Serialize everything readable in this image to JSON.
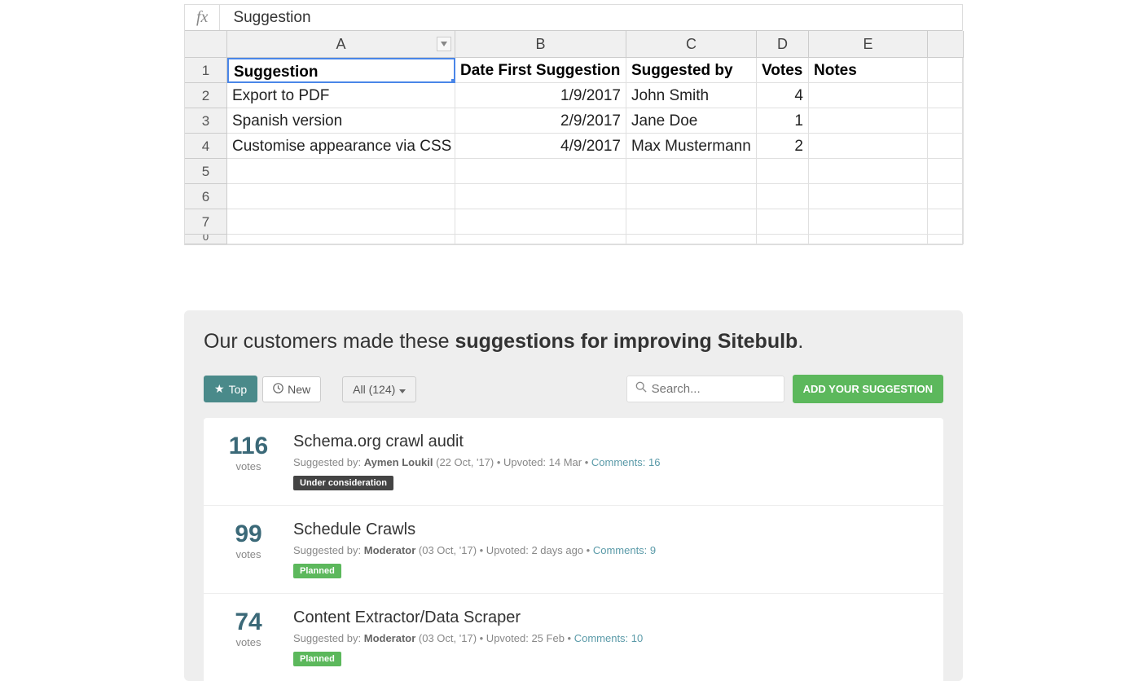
{
  "spreadsheet": {
    "formula_bar": "Suggestion",
    "columns": [
      "A",
      "B",
      "C",
      "D",
      "E"
    ],
    "row_numbers": [
      "1",
      "2",
      "3",
      "4",
      "5",
      "6",
      "7"
    ],
    "headers": [
      "Suggestion",
      "Date First Suggestion",
      "Suggested by",
      "Votes",
      "Notes"
    ],
    "rows": [
      {
        "a": "Export to PDF",
        "b": "1/9/2017",
        "c": "John Smith",
        "d": "4",
        "e": ""
      },
      {
        "a": "Spanish version",
        "b": "2/9/2017",
        "c": "Jane Doe",
        "d": "1",
        "e": ""
      },
      {
        "a": "Customise appearance via CSS",
        "b": "4/9/2017",
        "c": "Max Mustermann",
        "d": "2",
        "e": ""
      }
    ]
  },
  "panel": {
    "heading_prefix": "Our customers made these ",
    "heading_bold": "suggestions for improving Sitebulb",
    "heading_suffix": ".",
    "top_label": "Top",
    "new_label": "New",
    "filter_label": "All (124)",
    "search_placeholder": "Search...",
    "add_label": "ADD YOUR SUGGESTION",
    "items": [
      {
        "votes": "116",
        "votes_label": "votes",
        "title": "Schema.org crawl audit",
        "suggested_prefix": "Suggested by: ",
        "author": "Aymen Loukil",
        "date": " (22 Oct, '17)",
        "upvoted": " • Upvoted: 14 Mar • ",
        "comments": "Comments: 16",
        "badge": "Under consideration",
        "badge_class": "under"
      },
      {
        "votes": "99",
        "votes_label": "votes",
        "title": "Schedule Crawls",
        "suggested_prefix": "Suggested by: ",
        "author": "Moderator",
        "date": " (03 Oct, '17)",
        "upvoted": " • Upvoted: 2 days ago • ",
        "comments": "Comments: 9",
        "badge": "Planned",
        "badge_class": "planned"
      },
      {
        "votes": "74",
        "votes_label": "votes",
        "title": "Content Extractor/Data Scraper",
        "suggested_prefix": "Suggested by: ",
        "author": "Moderator",
        "date": " (03 Oct, '17)",
        "upvoted": " • Upvoted: 25 Feb • ",
        "comments": "Comments: 10",
        "badge": "Planned",
        "badge_class": "planned"
      }
    ]
  }
}
